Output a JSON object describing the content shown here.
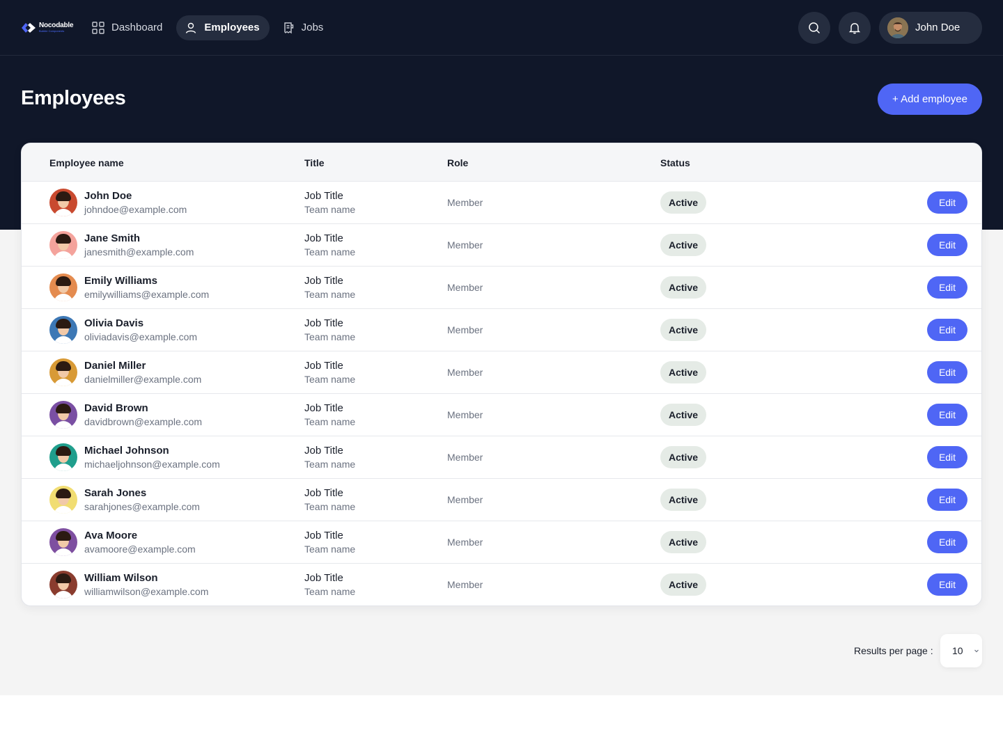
{
  "brand": {
    "name": "Nocodable",
    "sub": "Bubble Components",
    "accent": "#4f66f5",
    "dark": "#101729"
  },
  "nav": {
    "items": [
      {
        "label": "Dashboard",
        "icon": "grid-icon",
        "active": false
      },
      {
        "label": "Employees",
        "icon": "user-icon",
        "active": true
      },
      {
        "label": "Jobs",
        "icon": "document-icon",
        "active": false
      }
    ]
  },
  "user": {
    "name": "John Doe"
  },
  "page": {
    "title": "Employees",
    "add_label": "+ Add employee"
  },
  "table": {
    "headers": {
      "name": "Employee name",
      "title": "Title",
      "role": "Role",
      "status": "Status"
    },
    "rows": [
      {
        "name": "John Doe",
        "email": "johndoe@example.com",
        "job_title": "Job Title",
        "team": "Team name",
        "role": "Member",
        "status": "Active",
        "action": "Edit",
        "avatar_bg": "#c94a2f"
      },
      {
        "name": "Jane Smith",
        "email": "janesmith@example.com",
        "job_title": "Job Title",
        "team": "Team name",
        "role": "Member",
        "status": "Active",
        "action": "Edit",
        "avatar_bg": "#f4a39c"
      },
      {
        "name": "Emily Williams",
        "email": "emilywilliams@example.com",
        "job_title": "Job Title",
        "team": "Team name",
        "role": "Member",
        "status": "Active",
        "action": "Edit",
        "avatar_bg": "#e48b4f"
      },
      {
        "name": "Olivia Davis",
        "email": "oliviadavis@example.com",
        "job_title": "Job Title",
        "team": "Team name",
        "role": "Member",
        "status": "Active",
        "action": "Edit",
        "avatar_bg": "#3d78b5"
      },
      {
        "name": "Daniel Miller",
        "email": "danielmiller@example.com",
        "job_title": "Job Title",
        "team": "Team name",
        "role": "Member",
        "status": "Active",
        "action": "Edit",
        "avatar_bg": "#d89a36"
      },
      {
        "name": "David Brown",
        "email": "davidbrown@example.com",
        "job_title": "Job Title",
        "team": "Team name",
        "role": "Member",
        "status": "Active",
        "action": "Edit",
        "avatar_bg": "#7a4fa3"
      },
      {
        "name": "Michael Johnson",
        "email": "michaeljohnson@example.com",
        "job_title": "Job Title",
        "team": "Team name",
        "role": "Member",
        "status": "Active",
        "action": "Edit",
        "avatar_bg": "#1f9e8c"
      },
      {
        "name": "Sarah Jones",
        "email": "sarahjones@example.com",
        "job_title": "Job Title",
        "team": "Team name",
        "role": "Member",
        "status": "Active",
        "action": "Edit",
        "avatar_bg": "#f1dd72"
      },
      {
        "name": "Ava Moore",
        "email": "avamoore@example.com",
        "job_title": "Job Title",
        "team": "Team name",
        "role": "Member",
        "status": "Active",
        "action": "Edit",
        "avatar_bg": "#7e4fa0"
      },
      {
        "name": "William Wilson",
        "email": "williamwilson@example.com",
        "job_title": "Job Title",
        "team": "Team name",
        "role": "Member",
        "status": "Active",
        "action": "Edit",
        "avatar_bg": "#8a3c2e"
      }
    ]
  },
  "pagination": {
    "label": "Results per page :",
    "value": "10"
  }
}
